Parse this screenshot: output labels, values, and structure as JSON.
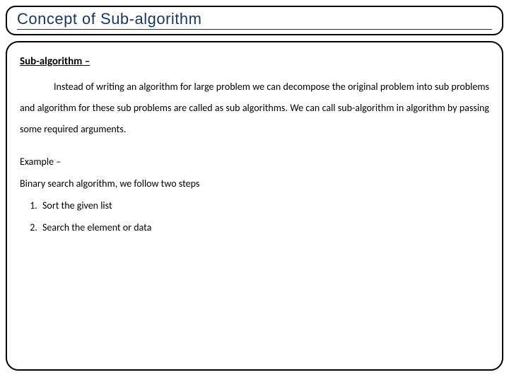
{
  "title": "Concept of Sub-algorithm",
  "subheading": "Sub-algorithm –",
  "body": "Instead of writing an algorithm for large problem we can decompose the original problem into sub problems and algorithm for these sub problems are called as sub algorithms. We can call sub-algorithm in algorithm by passing some required arguments.",
  "example_label": "Example –",
  "steps_intro": "Binary search algorithm, we follow two steps",
  "steps": [
    "Sort the given list",
    "Search the element or data"
  ]
}
